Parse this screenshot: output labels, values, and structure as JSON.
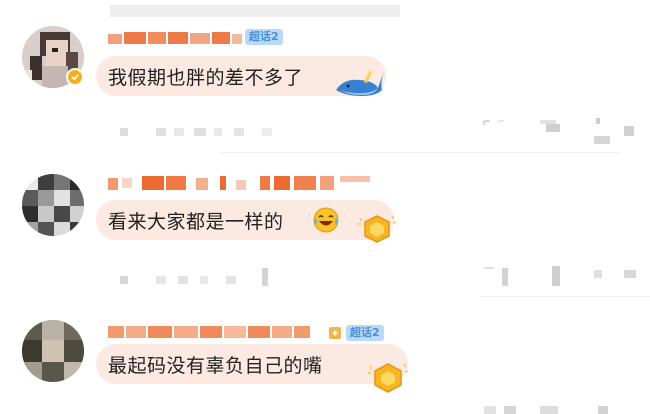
{
  "comments": [
    {
      "username_badge": "超话2",
      "text": "我假期也胖的差不多了",
      "sticker_icon": "blue-whale-sticker",
      "verified": true
    },
    {
      "username_badge": "",
      "text": "看来大家都是一样的",
      "emoji_icon": "laughing-tears-emoji",
      "sticker_icon": "golden-hexagon-sticker",
      "verified": false
    },
    {
      "username_badge": "超话2",
      "text": "最起码没有辜负自己的嘴",
      "sticker_icon": "golden-hexagon-sticker",
      "verified": false
    }
  ],
  "colors": {
    "bubble": "#fbe9e2",
    "text": "#222222",
    "username": "#ee6a33",
    "badge_bg": "#b9d9f6",
    "badge_text": "#4a8fd6",
    "verified": "#f6b01e"
  }
}
